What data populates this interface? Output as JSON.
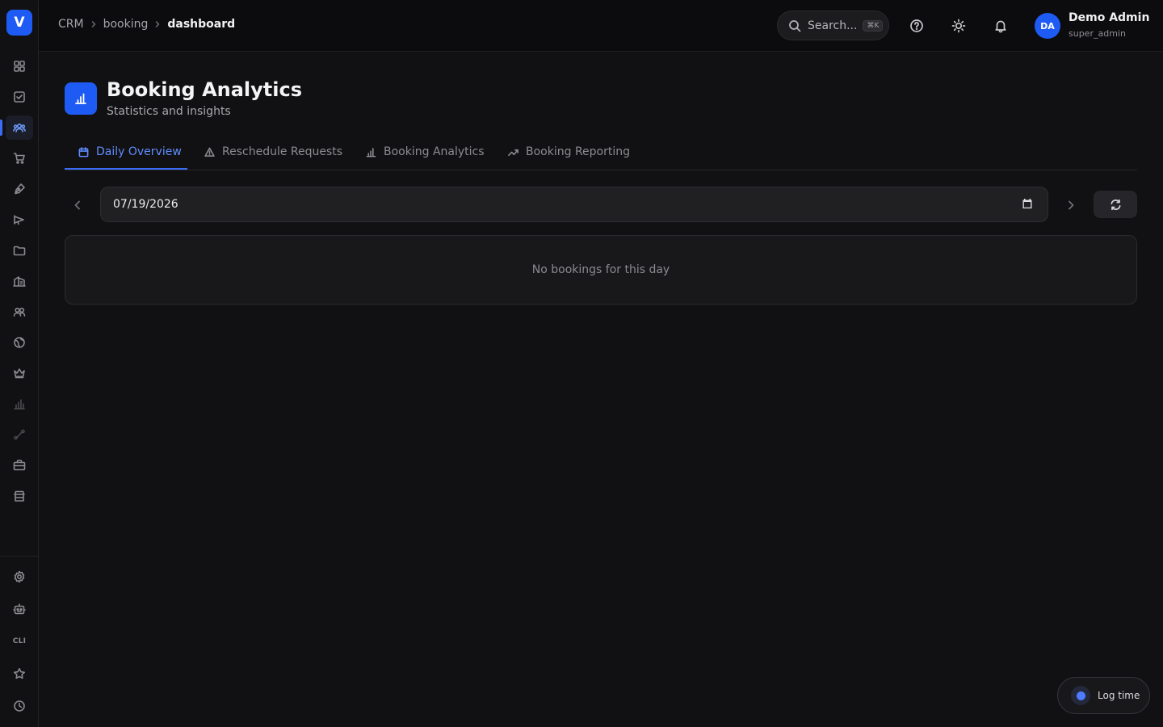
{
  "brand": {
    "logo_letter": "V",
    "accent": "#1e5bf5"
  },
  "sidebar": {
    "items": [
      {
        "icon": "grid-icon"
      },
      {
        "icon": "checkbox-icon"
      },
      {
        "icon": "users-icon",
        "active": true
      },
      {
        "icon": "cart-icon"
      },
      {
        "icon": "pen-nib-icon"
      },
      {
        "icon": "megaphone-icon"
      },
      {
        "icon": "folder-icon"
      },
      {
        "icon": "building-icon"
      },
      {
        "icon": "handshake-icon"
      },
      {
        "icon": "globe-icon"
      },
      {
        "icon": "crown-icon"
      },
      {
        "icon": "bar-chart-icon"
      },
      {
        "icon": "route-icon"
      },
      {
        "icon": "briefcase-icon"
      },
      {
        "icon": "store-icon"
      }
    ],
    "bottom_items": [
      {
        "icon": "settings-icon"
      },
      {
        "icon": "robot-icon"
      },
      {
        "icon": "cli-icon",
        "label": "CLI"
      },
      {
        "icon": "star-icon"
      },
      {
        "icon": "clock-icon"
      }
    ]
  },
  "header": {
    "breadcrumb": [
      "CRM",
      "booking",
      "dashboard"
    ],
    "search": {
      "placeholder": "Search...",
      "shortcut": "⌘K"
    },
    "icons": [
      "help-icon",
      "theme-sun-icon",
      "bell-icon"
    ],
    "user": {
      "initials": "DA",
      "name": "Demo Admin",
      "role": "super_admin"
    }
  },
  "page": {
    "title": "Booking Analytics",
    "subtitle": "Statistics and insights",
    "tabs": [
      {
        "label": "Daily Overview",
        "icon": "calendar-icon",
        "active": true
      },
      {
        "label": "Reschedule Requests",
        "icon": "warning-icon"
      },
      {
        "label": "Booking Analytics",
        "icon": "bar-chart-icon"
      },
      {
        "label": "Booking Reporting",
        "icon": "trending-up-icon"
      }
    ],
    "date_value": "07/19/2026",
    "empty_message": "No bookings for this day"
  },
  "log_time": {
    "label": "Log time"
  }
}
